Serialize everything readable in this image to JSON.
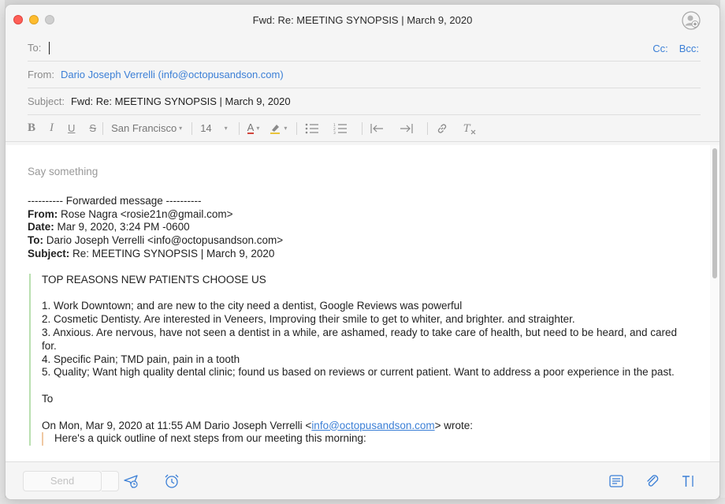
{
  "window": {
    "title": "Fwd: Re: MEETING SYNOPSIS | March 9, 2020"
  },
  "header": {
    "to_label": "To:",
    "cc_label": "Cc:",
    "bcc_label": "Bcc:",
    "from_label": "From:",
    "from_value": "Dario Joseph Verrelli (info@octopusandson.com)",
    "subject_label": "Subject:",
    "subject_value": "Fwd: Re: MEETING SYNOPSIS | March 9, 2020"
  },
  "toolbar": {
    "bold": "B",
    "italic": "I",
    "underline": "U",
    "strike": "S",
    "font_name": "San Francisco",
    "font_size": "14",
    "text_color": "A"
  },
  "body": {
    "placeholder": "Say something",
    "forward_header": "---------- Forwarded message ----------",
    "from_key": "From:",
    "from_val": " Rose Nagra <rosie21n@gmail.com>",
    "date_key": "Date:",
    "date_val": " Mar 9, 2020, 3:24 PM -0600",
    "to_key": "To:",
    "to_val": " Dario Joseph Verrelli <info@octopusandson.com>",
    "subject_key": "Subject:",
    "subject_val": " Re: MEETING SYNOPSIS | March 9, 2020",
    "heading": "TOP REASONS NEW PATIENTS CHOOSE US",
    "reasons": [
      "1. Work Downtown; and are new to the city need a dentist, Google Reviews was powerful",
      "2. Cosmetic Dentisty. Are interested in Veneers, Improving their smile to get to whiter, and brighter. and straighter.",
      "3. Anxious. Are nervous, have not seen a dentist in a while, are ashamed, ready to take care of health, but need to be heard, and cared for.",
      "4. Specific Pain; TMD pain, pain in a tooth",
      "5. Quality; Want high quality dental clinic; found us based on reviews or current patient. Want to address a poor experience in the past."
    ],
    "to_line": "To",
    "wrote_prefix": "On Mon, Mar 9, 2020 at 11:55 AM Dario Joseph Verrelli <",
    "wrote_link": "info@octopusandson.com",
    "wrote_suffix": "> wrote:",
    "inner_line": "Here's a quick outline of next steps from our meeting this morning:"
  },
  "footer": {
    "send_label": "Send"
  },
  "colors": {
    "accent": "#3b7fd6",
    "quote_bar": "#b9dfb0",
    "inner_quote_bar": "#f0c8a3"
  },
  "icons": [
    "person-add-icon",
    "send-later-icon",
    "alarm-icon",
    "template-icon",
    "attachment-icon",
    "text-format-icon"
  ]
}
